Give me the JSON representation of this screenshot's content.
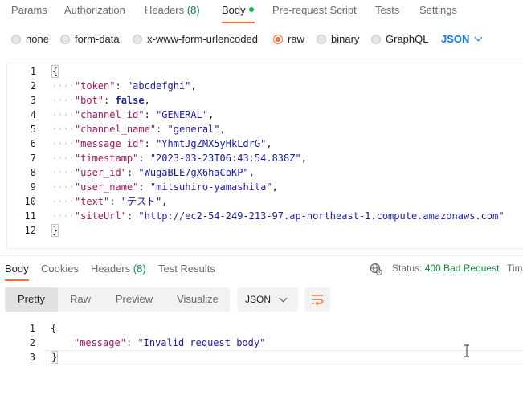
{
  "request_tabs": [
    {
      "label": "Params"
    },
    {
      "label": "Authorization"
    },
    {
      "label": "Headers",
      "count": "(8)"
    },
    {
      "label": "Body"
    },
    {
      "label": "Pre-request Script"
    },
    {
      "label": "Tests"
    },
    {
      "label": "Settings"
    }
  ],
  "body_types": [
    {
      "label": "none"
    },
    {
      "label": "form-data"
    },
    {
      "label": "x-www-form-urlencoded"
    },
    {
      "label": "raw"
    },
    {
      "label": "binary"
    },
    {
      "label": "GraphQL"
    }
  ],
  "selected_body_type": "raw",
  "language": "JSON",
  "request_body": {
    "open": "{",
    "close": "}",
    "lines": [
      {
        "key": "\"token\"",
        "value": "\"abcdefghi\"",
        "type": "string",
        "comma": ","
      },
      {
        "key": "\"bot\"",
        "value": "false",
        "type": "bool",
        "comma": ","
      },
      {
        "key": "\"channel_id\"",
        "value": "\"GENERAL\"",
        "type": "string",
        "comma": ","
      },
      {
        "key": "\"channel_name\"",
        "value": "\"general\"",
        "type": "string",
        "comma": ","
      },
      {
        "key": "\"message_id\"",
        "value": "\"YhmtJgZMX5yHkLdrG\"",
        "type": "string",
        "comma": ","
      },
      {
        "key": "\"timestamp\"",
        "value": "\"2023-03-23T06:43:54.838Z\"",
        "type": "string",
        "comma": ","
      },
      {
        "key": "\"user_id\"",
        "value": "\"WugaBLE7gX6haCbKP\"",
        "type": "string",
        "comma": ","
      },
      {
        "key": "\"user_name\"",
        "value": "\"mitsuhiro-yamashita\"",
        "type": "string",
        "comma": ","
      },
      {
        "key": "\"text\"",
        "value": "\"テスト\"",
        "type": "string",
        "comma": ","
      },
      {
        "key": "\"siteUrl\"",
        "value": "\"http://ec2-54-249-213-97.ap-northeast-1.compute.amazonaws.com\"",
        "type": "string",
        "comma": ""
      }
    ],
    "line_numbers": [
      "1",
      "2",
      "3",
      "4",
      "5",
      "6",
      "7",
      "8",
      "9",
      "10",
      "11",
      "12"
    ]
  },
  "response_tabs": [
    {
      "label": "Body"
    },
    {
      "label": "Cookies"
    },
    {
      "label": "Headers",
      "count": "(8)"
    },
    {
      "label": "Test Results"
    }
  ],
  "status": {
    "label": "Status:",
    "value": "400 Bad Request",
    "time_cut": "Tim"
  },
  "view_modes": [
    "Pretty",
    "Raw",
    "Preview",
    "Visualize"
  ],
  "active_view": "Pretty",
  "response_format": "JSON",
  "response_body": {
    "line_numbers": [
      "1",
      "2",
      "3"
    ],
    "open": "{",
    "key": "\"message\"",
    "value": "\"Invalid request body\"",
    "close": "}"
  }
}
